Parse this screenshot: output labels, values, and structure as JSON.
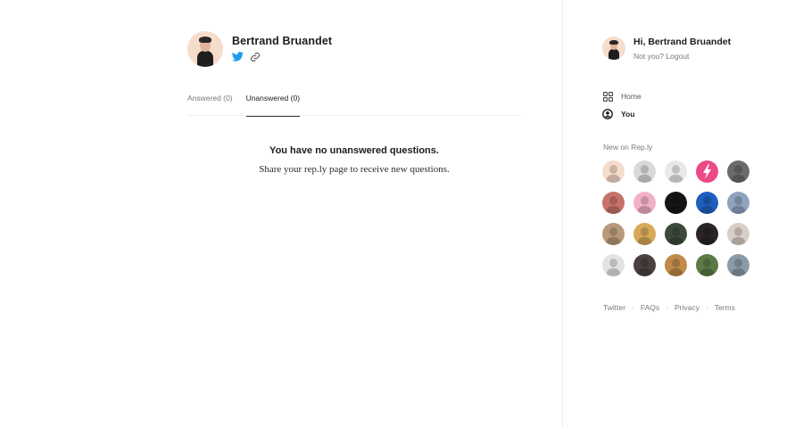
{
  "profile": {
    "name": "Bertrand Bruandet",
    "twitter_color": "#1d9bf0"
  },
  "tabs": [
    {
      "label": "Answered (0)",
      "active": false
    },
    {
      "label": "Unanswered (0)",
      "active": true
    }
  ],
  "empty_state": {
    "title": "You have no unanswered questions.",
    "subtitle": "Share your rep.ly page to receive new questions."
  },
  "sidebar": {
    "greeting": "Hi, Bertrand Bruandet",
    "not_you": "Not you?",
    "logout": "Logout",
    "nav": [
      {
        "label": "Home",
        "icon": "grid-icon",
        "active": false
      },
      {
        "label": "You",
        "icon": "user-circle-icon",
        "active": true
      }
    ],
    "new_title": "New on Rep.ly",
    "new_users": [
      {
        "bg": "#f6dccb"
      },
      {
        "bg": "#d9d9d9"
      },
      {
        "bg": "#e9e9e9"
      },
      {
        "bg": "#ec4a86"
      },
      {
        "bg": "#6b6b6b"
      },
      {
        "bg": "#c7726a"
      },
      {
        "bg": "#f3b0c6"
      },
      {
        "bg": "#151515"
      },
      {
        "bg": "#1f5fbf"
      },
      {
        "bg": "#8fa3bf"
      },
      {
        "bg": "#b89a7a"
      },
      {
        "bg": "#d8a85a"
      },
      {
        "bg": "#3b4a3b"
      },
      {
        "bg": "#2a2424"
      },
      {
        "bg": "#d8cfc6"
      },
      {
        "bg": "#e3e3e3"
      },
      {
        "bg": "#4a4040"
      },
      {
        "bg": "#c08a4a"
      },
      {
        "bg": "#5c7a45"
      },
      {
        "bg": "#8a9aa6"
      }
    ],
    "footer": [
      "Twitter",
      "FAQs",
      "Privacy",
      "Terms"
    ]
  },
  "colors": {
    "accent_pink": "#ec4a86",
    "text_muted": "#7a7a7a"
  }
}
